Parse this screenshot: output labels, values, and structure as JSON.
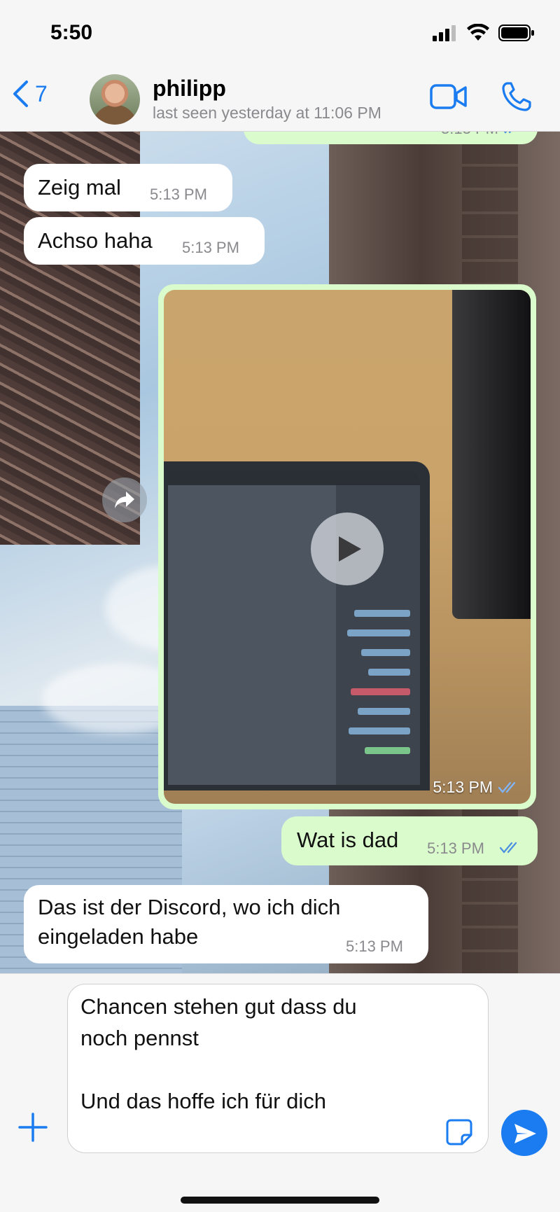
{
  "status_bar": {
    "time": "5:50"
  },
  "header": {
    "back_count": "7",
    "contact_name": "philipp",
    "last_seen": "last seen yesterday at 11:06 PM",
    "icons": {
      "back": "chevron-left-icon",
      "video": "video-camera-icon",
      "call": "phone-icon"
    }
  },
  "messages": [
    {
      "direction": "in",
      "text": "Zeig mal",
      "time": "5:13 PM"
    },
    {
      "direction": "in",
      "text": "Achso haha",
      "time": "5:13 PM"
    },
    {
      "direction": "out",
      "type": "video",
      "time": "5:13 PM",
      "read": true
    },
    {
      "direction": "out",
      "text": "Wat is dad",
      "time": "5:13 PM",
      "read": true
    },
    {
      "direction": "in",
      "text_line1": "Das ist der Discord, wo ich dich",
      "text_line2": "eingeladen habe",
      "time": "5:13 PM"
    }
  ],
  "top_partial_time": "5:13 PM",
  "composer": {
    "text": "Chancen stehen gut dass du\nnoch pennst\n\nUnd das hoffe ich für dich"
  },
  "colors": {
    "accent": "#1a7cf0",
    "outgoing_bubble": "#dafbcb",
    "incoming_bubble": "#ffffff",
    "read_tick": "#4a90e2"
  }
}
